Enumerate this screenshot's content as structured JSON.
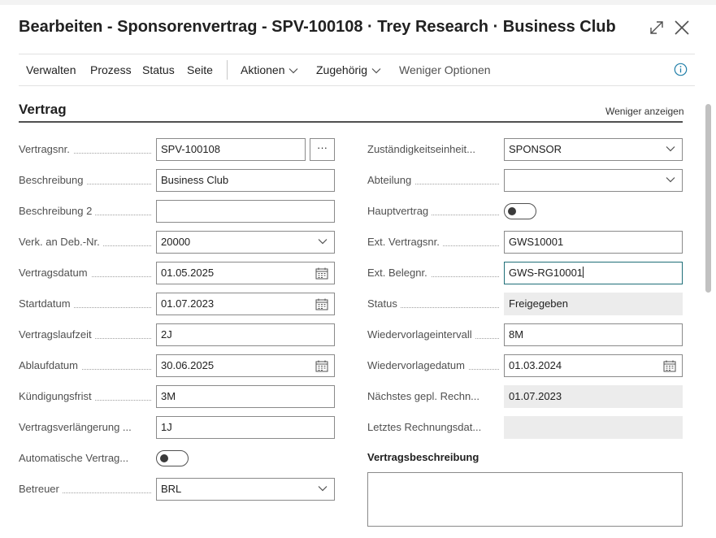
{
  "window": {
    "title": "Bearbeiten - Sponsorenvertrag - SPV-100108 · Trey Research · Business Club"
  },
  "toolbar": {
    "items": [
      "Verwalten",
      "Prozess",
      "Status",
      "Seite",
      "Aktionen",
      "Zugehörig",
      "Weniger Optionen"
    ]
  },
  "section": {
    "title": "Vertrag",
    "toggle_label": "Weniger anzeigen"
  },
  "left": [
    {
      "label": "Vertragsnr.",
      "value": "SPV-100108"
    },
    {
      "label": "Beschreibung",
      "value": "Business Club"
    },
    {
      "label": "Beschreibung 2",
      "value": ""
    },
    {
      "label": "Verk. an Deb.-Nr.",
      "value": "20000"
    },
    {
      "label": "Vertragsdatum",
      "value": "01.05.2025"
    },
    {
      "label": "Startdatum",
      "value": "01.07.2023"
    },
    {
      "label": "Vertragslaufzeit",
      "value": "2J"
    },
    {
      "label": "Ablaufdatum",
      "value": "30.06.2025"
    },
    {
      "label": "Kündigungsfrist",
      "value": "3M"
    },
    {
      "label": "Vertragsverlängerung ...",
      "value": "1J"
    },
    {
      "label": "Automatische Vertrag...",
      "value": false
    },
    {
      "label": "Betreuer",
      "value": "BRL"
    }
  ],
  "right": [
    {
      "label": "Zuständigkeitseinheit...",
      "value": "SPONSOR"
    },
    {
      "label": "Abteilung",
      "value": ""
    },
    {
      "label": "Hauptvertrag",
      "value": false
    },
    {
      "label": "Ext. Vertragsnr.",
      "value": "GWS10001"
    },
    {
      "label": "Ext. Belegnr.",
      "value": "GWS-RG10001"
    },
    {
      "label": "Status",
      "value": "Freigegeben"
    },
    {
      "label": "Wiedervorlageintervall",
      "value": "8M"
    },
    {
      "label": "Wiedervorlagedatum",
      "value": "01.03.2024"
    },
    {
      "label": "Nächstes gepl. Rechn...",
      "value": "01.07.2023"
    },
    {
      "label": "Letztes Rechnungsdat...",
      "value": ""
    }
  ],
  "description": {
    "label": "Vertragsbeschreibung",
    "value": ""
  },
  "ellipsis_label": "···",
  "colors": {
    "focus_border": "#1f6f78",
    "info_icon": "#1f7ea8"
  }
}
